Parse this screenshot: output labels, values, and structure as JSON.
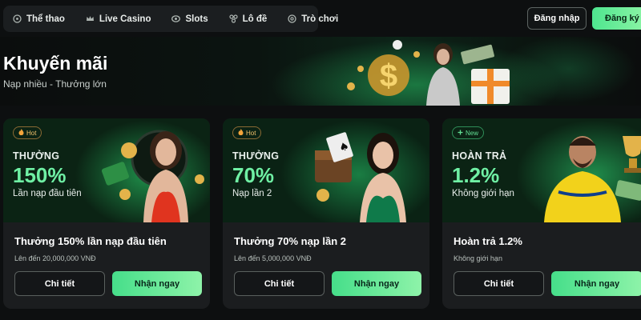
{
  "nav": {
    "items": [
      {
        "label": "Thể thao",
        "icon": "soccer-ball-icon"
      },
      {
        "label": "Live Casino",
        "icon": "crown-icon"
      },
      {
        "label": "Slots",
        "icon": "slot-machine-icon"
      },
      {
        "label": "Lô đề",
        "icon": "lottery-balls-icon"
      },
      {
        "label": "Trò chơi",
        "icon": "gamepad-icon"
      }
    ],
    "login_label": "Đăng nhập",
    "register_label": "Đăng ký"
  },
  "hero": {
    "title": "Khuyến mãi",
    "subtitle": "Nạp nhiều - Thưởng lớn"
  },
  "promotions": [
    {
      "badge": "Hot",
      "badge_icon": "flame-icon",
      "label": "THƯỞNG",
      "value": "150%",
      "desc": "Lần nạp đầu tiên",
      "title": "Thưởng 150% lần nạp đầu tiên",
      "subtitle": "Lên đến 20,000,000 VNĐ",
      "detail_label": "Chi tiết",
      "claim_label": "Nhận ngay"
    },
    {
      "badge": "Hot",
      "badge_icon": "flame-icon",
      "label": "THƯỞNG",
      "value": "70%",
      "desc": "Nạp lần 2",
      "title": "Thưởng 70% nạp lần 2",
      "subtitle": "Lên đến 5,000,000 VNĐ",
      "detail_label": "Chi tiết",
      "claim_label": "Nhận ngay"
    },
    {
      "badge": "New",
      "badge_icon": "plus-icon",
      "label": "HOÀN TRẢ",
      "value": "1.2%",
      "desc": "Không giới hạn",
      "title": "Hoàn trả 1.2%",
      "subtitle": "Không giới hạn",
      "detail_label": "Chi tiết",
      "claim_label": "Nhận ngay"
    }
  ],
  "colors": {
    "accent_green": "#6ff0a4",
    "button_gradient_start": "#46de8a",
    "button_gradient_end": "#8ef3a9",
    "hot_badge": "#f2c36b",
    "background": "#0d0f10",
    "card_background": "#1b1d1f"
  }
}
